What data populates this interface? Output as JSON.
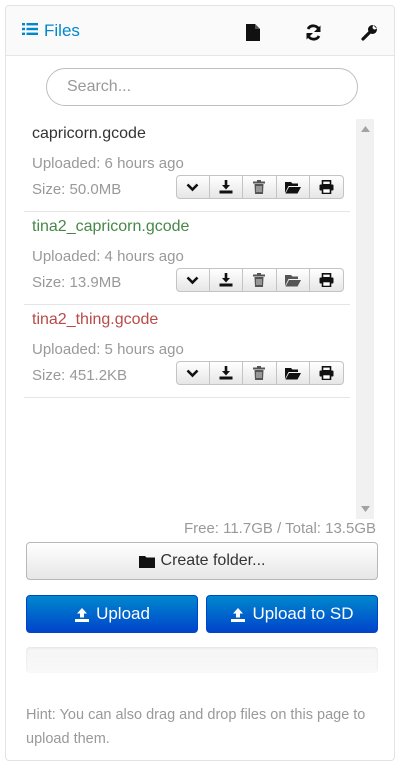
{
  "header": {
    "title": "Files",
    "icons": [
      "list-icon",
      "new-file-icon",
      "refresh-icon",
      "wrench-icon"
    ]
  },
  "search": {
    "value": "",
    "placeholder": "Search..."
  },
  "files": [
    {
      "name": "capricorn.gcode",
      "uploaded": "Uploaded: 6 hours ago",
      "size": "Size: 50.0MB",
      "name_color": "#333333"
    },
    {
      "name": "tina2_capricorn.gcode",
      "uploaded": "Uploaded: 4 hours ago",
      "size": "Size: 13.9MB",
      "name_color": "#468847"
    },
    {
      "name": "tina2_thing.gcode",
      "uploaded": "Uploaded: 5 hours ago",
      "size": "Size: 451.2KB",
      "name_color": "#b94a48"
    }
  ],
  "file_action_icons": [
    "chevron-down-icon",
    "download-icon",
    "trash-icon",
    "folder-open-icon",
    "print-icon"
  ],
  "usage": "Free: 11.7GB / Total: 13.5GB",
  "buttons": {
    "create_folder": "Create folder...",
    "upload": "Upload",
    "upload_sd": "Upload to SD"
  },
  "upload_progress": 0,
  "hint": "Hint: You can also drag and drop files on this page to upload them.",
  "colors": {
    "accent": "#0088cc",
    "primary_button": "#0055cc",
    "muted_text": "#999999"
  }
}
